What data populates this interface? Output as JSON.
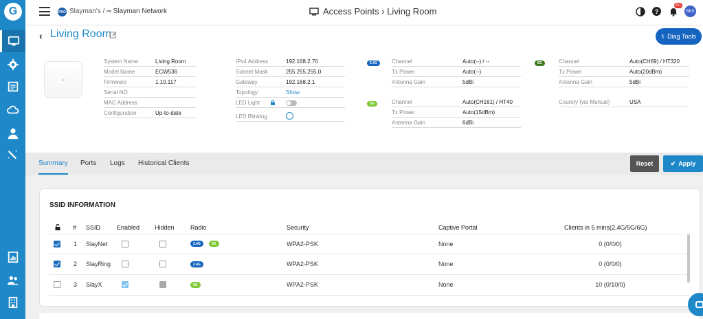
{
  "breadcrumb": {
    "org": "Slayman's /",
    "network": "Slayman Network",
    "pro_badge": "PRO"
  },
  "page_heading": "Access Points › Living Room",
  "topbar": {
    "notification_count": "251",
    "user_initials": "BKS",
    "help": "?"
  },
  "sidebar": {
    "logo": "G",
    "icons": [
      "monitor-icon",
      "gear-icon",
      "list-icon",
      "cloud-icon",
      "user-icon",
      "magic-wand-icon",
      "report-icon",
      "users-icon",
      "building-icon"
    ]
  },
  "device": {
    "title": "Living Room",
    "diag_tools": "Diag Tools",
    "system": [
      {
        "label": "System Name",
        "value": "Living Room"
      },
      {
        "label": "Model Name",
        "value": "ECW536"
      },
      {
        "label": "Firmware",
        "value": "1.10.117"
      },
      {
        "label": "Serial NO.",
        "value": ""
      },
      {
        "label": "MAC Address",
        "value": ""
      },
      {
        "label": "Configuration",
        "value": "Up-to-date"
      }
    ],
    "network": [
      {
        "label": "IPv4 Address",
        "value": "192.168.2.70"
      },
      {
        "label": "Subnet Mask",
        "value": "255.255.255.0"
      },
      {
        "label": "Gateway",
        "value": "192.168.2.1"
      },
      {
        "label": "Topology",
        "value": "Show"
      },
      {
        "label": "LED Light",
        "value": ""
      },
      {
        "label": "LED Blinking",
        "value": ""
      }
    ],
    "radio_24": {
      "tag": "2.4G",
      "rows": [
        {
          "label": "Channel",
          "value": "Auto(--) / --"
        },
        {
          "label": "Tx Power",
          "value": "Auto(--)"
        },
        {
          "label": "Antenna Gain",
          "value": "5dBi"
        }
      ]
    },
    "radio_5": {
      "tag": "5G",
      "rows": [
        {
          "label": "Channel",
          "value": "Auto(CH161) / HT40"
        },
        {
          "label": "Tx Power",
          "value": "Auto(15dBm)"
        },
        {
          "label": "Antenna Gain",
          "value": "6dBi"
        }
      ]
    },
    "radio_6": {
      "tag": "6G",
      "rows": [
        {
          "label": "Channel",
          "value": "Auto(CH69) / HT320"
        },
        {
          "label": "Tx Power",
          "value": "Auto(20dBm)"
        },
        {
          "label": "Antenna Gain",
          "value": "5dBi"
        }
      ]
    },
    "country": {
      "label": "Country (via Manual)",
      "value": "USA"
    }
  },
  "tabs": [
    "Summary",
    "Ports",
    "Logs",
    "Historical Clients"
  ],
  "actions": {
    "reset": "Reset",
    "apply": "Apply"
  },
  "colors": {
    "accent": "#1e88c8",
    "tag_24": "#1565c0",
    "tag_5": "#7cc832",
    "tag_6": "#3d7a1e"
  },
  "ssid": {
    "title": "SSID INFORMATION",
    "columns": [
      "#",
      "SSID",
      "Enabled",
      "Hidden",
      "Radio",
      "Security",
      "Captive Portal",
      "Clients in 5 mins(2.4G/5G/6G)"
    ],
    "rows": [
      {
        "num": "1",
        "ssid": "SlayNet",
        "security": "WPA2-PSK",
        "portal": "None",
        "clients": "0 (0/0/0)",
        "radios": [
          "2.4G",
          "5G"
        ]
      },
      {
        "num": "2",
        "ssid": "SlayRing",
        "security": "WPA2-PSK",
        "portal": "None",
        "clients": "0 (0/0/0)",
        "radios": [
          "2.4G"
        ]
      },
      {
        "num": "3",
        "ssid": "SlayX",
        "security": "WPA2-PSK",
        "portal": "None",
        "clients": "10 (0/10/0)",
        "radios": [
          "5G"
        ]
      }
    ]
  }
}
